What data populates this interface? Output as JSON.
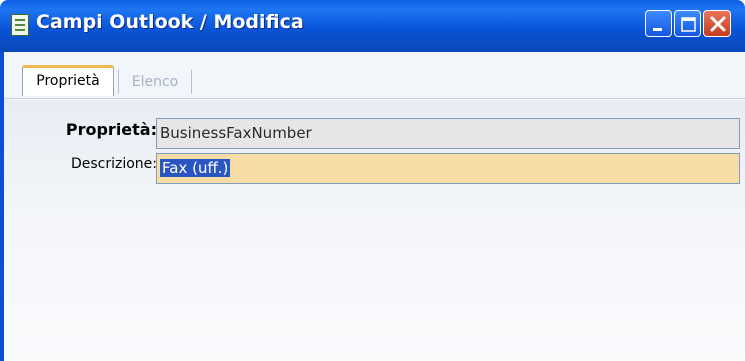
{
  "window": {
    "title": "Campi Outlook / Modifica",
    "controls": [
      "minimize-icon",
      "maximize-icon",
      "close-icon"
    ]
  },
  "tabs": [
    {
      "label": "Proprietà",
      "active": true
    },
    {
      "label": "Elenco",
      "active": false
    }
  ],
  "form": {
    "proprieta_label": "Proprietà:",
    "proprieta_value": "BusinessFaxNumber",
    "descrizione_label": "Descrizione:",
    "descrizione_value": "Fax (uff.)"
  },
  "colors": {
    "titlebar": "#0a54d8",
    "readonly_field": "#e6e6e6",
    "editable_field": "#f8dca6",
    "selection": "#2a56c4"
  }
}
